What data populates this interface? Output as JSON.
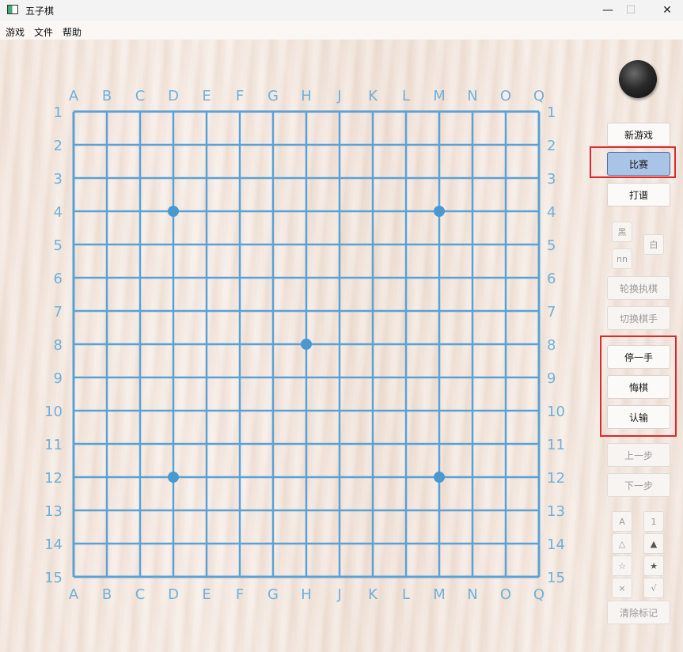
{
  "window": {
    "title": "五子棋",
    "controls": {
      "minimize": "—",
      "maximize": "☐",
      "close": "✕"
    }
  },
  "menu": [
    "游戏",
    "文件",
    "帮助"
  ],
  "board": {
    "columns": [
      "A",
      "B",
      "C",
      "D",
      "E",
      "F",
      "G",
      "H",
      "J",
      "K",
      "L",
      "M",
      "N",
      "O",
      "Q"
    ],
    "rows": [
      "1",
      "2",
      "3",
      "4",
      "5",
      "6",
      "7",
      "8",
      "9",
      "10",
      "11",
      "12",
      "13",
      "14",
      "15"
    ],
    "star_points": [
      "D4",
      "M4",
      "H8",
      "D12",
      "M12"
    ],
    "line_color": "#5aa2d6",
    "label_color": "#6fb0db",
    "star_color": "#4a98d0"
  },
  "side": {
    "current_player_stone": "black-stone",
    "new_game": "新游戏",
    "match": "比赛",
    "record": "打谱",
    "black": "黑",
    "white": "白",
    "nn": "nn",
    "swap_color": "轮换执棋",
    "switch_player": "切换棋手",
    "pass": "停一手",
    "undo": "悔棋",
    "resign": "认输",
    "prev_step": "上一步",
    "next_step": "下一步",
    "marks": [
      "A",
      "1",
      "△",
      "▲",
      "☆",
      "★",
      "×",
      "√"
    ],
    "clear_marks": "清除标记"
  },
  "colors": {
    "active_button": "#a9c4e6",
    "highlight": "#e0282b"
  }
}
